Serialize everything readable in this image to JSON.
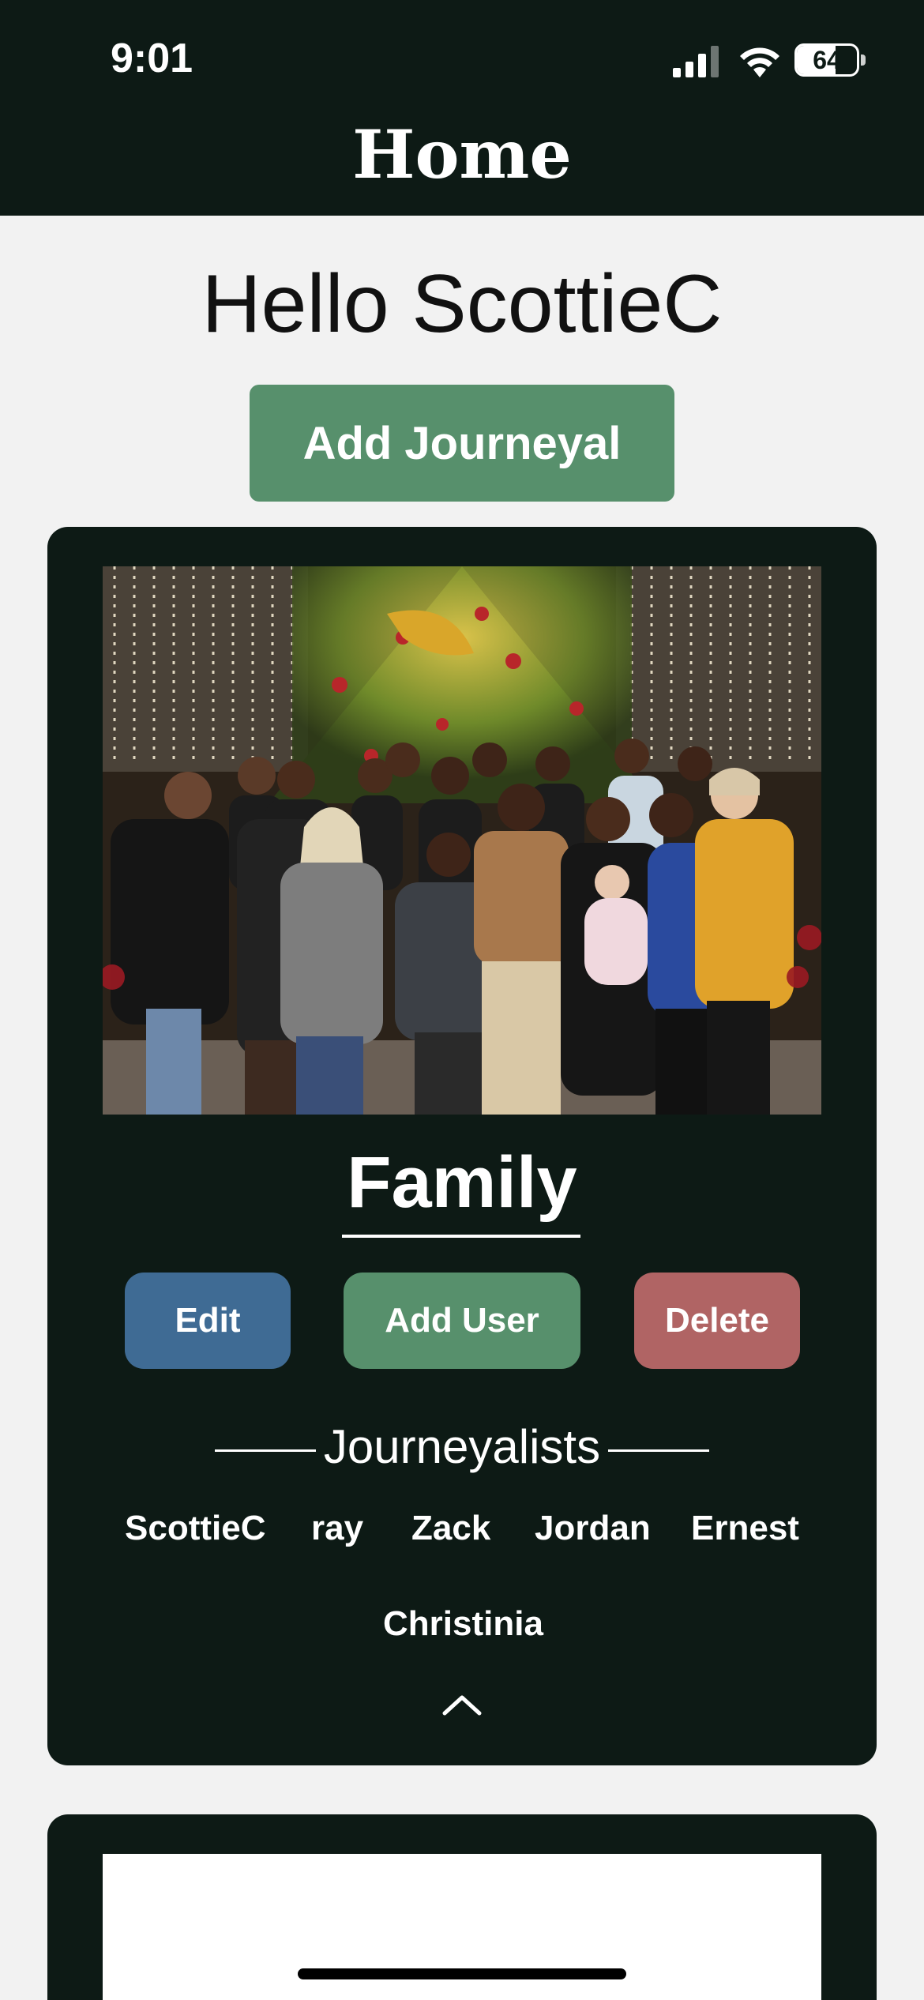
{
  "status_bar": {
    "time": "9:01",
    "battery_level": "64",
    "battery_fraction": 0.64,
    "icons": [
      "signal-icon",
      "wifi-icon",
      "battery-icon"
    ]
  },
  "nav": {
    "title": "Home"
  },
  "greeting": "Hello ScottieC",
  "add_journeyal_label": "Add Journeyal",
  "journeyal_card": {
    "title": "Family",
    "photo_description_icon": "family-group-photo",
    "buttons": {
      "edit": "Edit",
      "add_user": "Add User",
      "delete": "Delete"
    },
    "section_label": "Journeyalists",
    "members": [
      "ScottieC",
      "ray",
      "Zack",
      "Jordan",
      "Ernest",
      "Christinia"
    ],
    "collapse_icon": "chevron-up-icon"
  },
  "colors": {
    "dark": "#0d1a15",
    "green": "#57906c",
    "blue": "#3f6b94",
    "red": "#b06464",
    "background": "#f2f2f2"
  }
}
